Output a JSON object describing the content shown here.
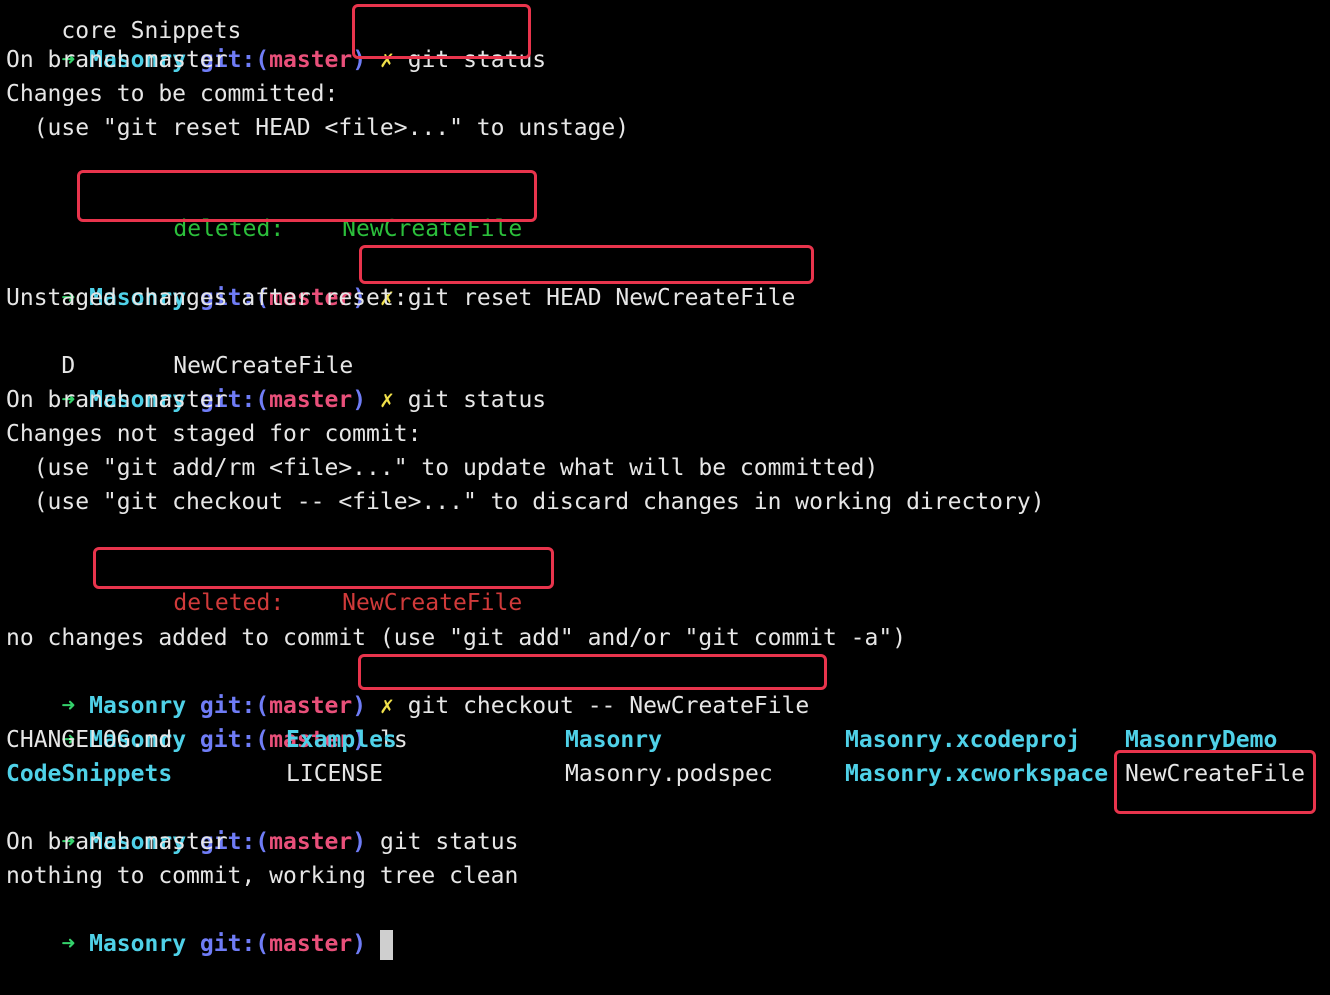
{
  "prompt": {
    "arrow": "➜",
    "dir": "Masonry",
    "git_prefix": "git:(",
    "branch": "master",
    "git_suffix": ")",
    "dirty_mark": "✗"
  },
  "lines": {
    "top_partial": "core Snippets",
    "cmd1": "git status",
    "l_on_branch_1": "On branch master",
    "l_changes_committed": "Changes to be committed:",
    "l_use_reset": "  (use \"git reset HEAD <file>...\" to unstage)",
    "staged_deleted_label": "deleted:",
    "staged_deleted_file": "NewCreateFile",
    "cmd2": "git reset HEAD NewCreateFile",
    "l_unstaged_after": "Unstaged changes after reset:",
    "l_d_status": "D",
    "l_d_file": "NewCreateFile",
    "cmd3": "git status",
    "l_on_branch_2": "On branch master",
    "l_changes_not_staged": "Changes not staged for commit:",
    "l_use_addrm": "  (use \"git add/rm <file>...\" to update what will be committed)",
    "l_use_checkout": "  (use \"git checkout -- <file>...\" to discard changes in working directory)",
    "unstaged_deleted_label": "deleted:",
    "unstaged_deleted_file": "NewCreateFile",
    "l_no_changes": "no changes added to commit (use \"git add\" and/or \"git commit -a\")",
    "cmd4": "git checkout -- NewCreateFile",
    "cmd5": "ls",
    "cmd6": "git status",
    "l_on_branch_3": "On branch master",
    "l_nothing": "nothing to commit, working tree clean"
  },
  "ls": {
    "row1": [
      "CHANGELOG.md",
      "Examples",
      "Masonry",
      "Masonry.xcodeproj",
      "MasonryDemo"
    ],
    "row2": [
      "CodeSnippets",
      "LICENSE",
      "Masonry.podspec",
      "Masonry.xcworkspace",
      "NewCreateFile"
    ]
  },
  "colors": {
    "background": "#000000",
    "highlight_border": "#e8344c",
    "staged_green": "#2bbf3b",
    "unstaged_red": "#d03a3a"
  }
}
